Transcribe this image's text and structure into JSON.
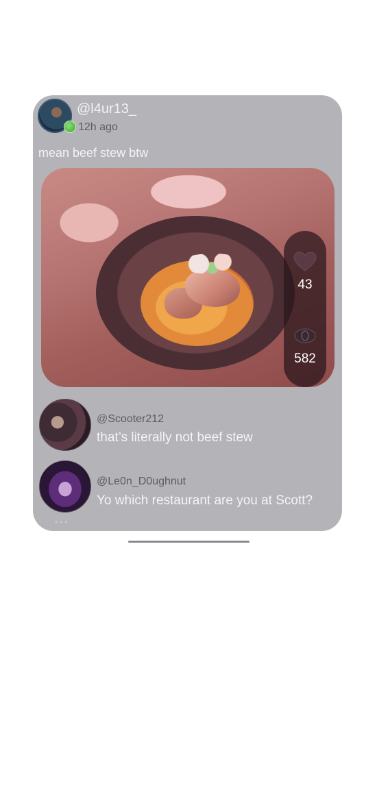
{
  "post": {
    "username": "@l4ur13_",
    "time_ago": "12h ago",
    "caption": "mean beef stew btw",
    "likes": "43",
    "comments_count": "582"
  },
  "comments": [
    {
      "username": "@Scooter212",
      "text": "that’s literally not beef stew"
    },
    {
      "username": "@Le0n_D0ughnut",
      "text": "Yo which restaurant are you at Scott?"
    }
  ],
  "colors": {
    "card_background": "#b4b3b8",
    "online_status": "#3aa12c",
    "stats_overlay": "#28161c"
  },
  "icons": {
    "like": "heart-icon",
    "comment": "comment-bubble-icon",
    "online": "online-status-icon"
  }
}
